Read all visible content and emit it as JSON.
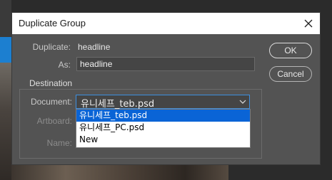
{
  "dialog": {
    "title": "Duplicate Group",
    "duplicate_label": "Duplicate:",
    "duplicate_value": "headline",
    "as_label": "As:",
    "as_value": "headline",
    "destination_title": "Destination",
    "document_label": "Document:",
    "document_selected": "유니세프_teb.psd",
    "artboard_label": "Artboard:",
    "name_label": "Name:",
    "options": [
      "유니세프_teb.psd",
      "유니세프_PC.psd",
      "New"
    ],
    "ok_label": "OK",
    "cancel_label": "Cancel"
  }
}
